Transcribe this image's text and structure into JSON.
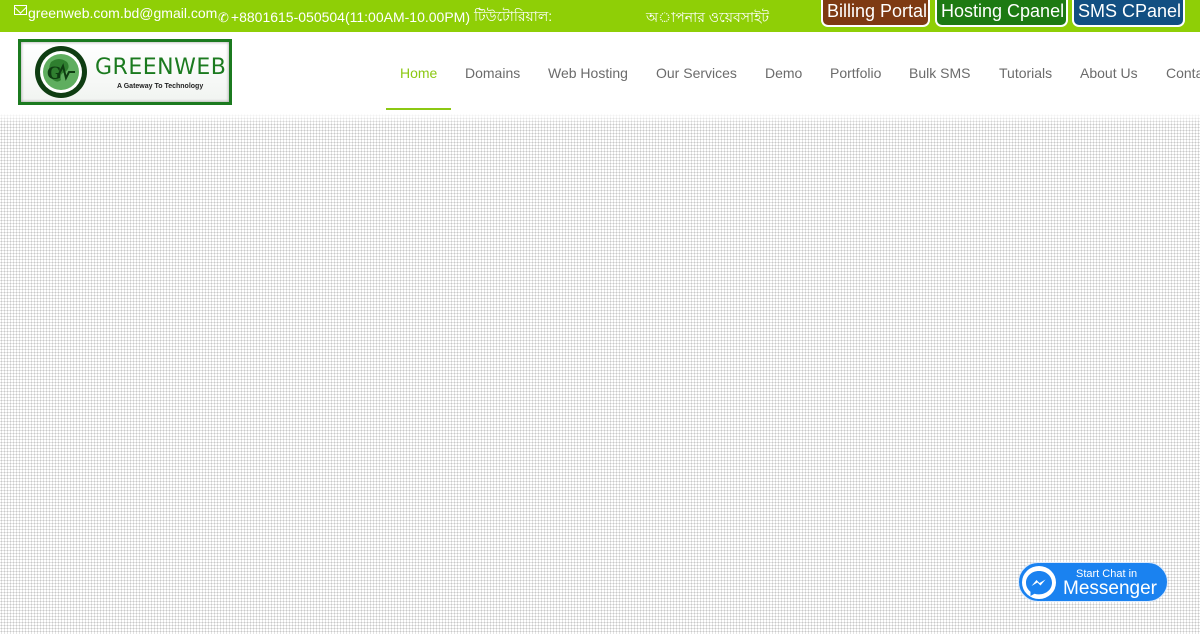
{
  "topbar": {
    "email": "greenweb.com.bd@gmail.com",
    "phone": "+8801615-050504(11:00AM-10.00PM)",
    "tutorial_label": "টিউটোরিয়াল:",
    "site_link": "অাপনার ওয়েবসাইট",
    "buttons": [
      {
        "label": "Billing Portal",
        "color": "#7e3a13"
      },
      {
        "label": "Hosting Cpanel",
        "color": "#1d7a12"
      },
      {
        "label": "SMS CPanel",
        "color": "#124f82"
      }
    ],
    "background": "#8fcf06"
  },
  "header": {
    "logo": {
      "title": "GREENWEB",
      "tagline": "A Gateway To Technology"
    },
    "nav": [
      {
        "label": "Home",
        "active": true
      },
      {
        "label": "Domains"
      },
      {
        "label": "Web Hosting"
      },
      {
        "label": "Our Services"
      },
      {
        "label": "Demo"
      },
      {
        "label": "Portfolio"
      },
      {
        "label": "Bulk SMS"
      },
      {
        "label": "Tutorials"
      },
      {
        "label": "About Us"
      },
      {
        "label": "Contact"
      }
    ],
    "accent": "#8cc813"
  },
  "messenger": {
    "line1": "Start Chat in",
    "line2": "Messenger",
    "color": "#1a82f0"
  }
}
